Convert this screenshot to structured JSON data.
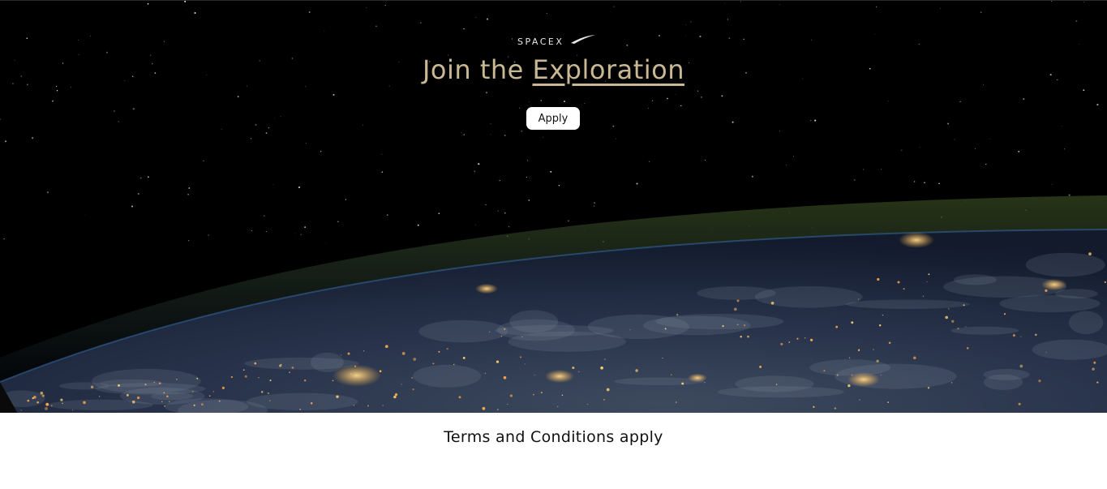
{
  "hero": {
    "logo_text": "SPACEX",
    "headline_prefix": "Join the ",
    "headline_accent": "Exploration",
    "apply_label": "Apply"
  },
  "footer": {
    "terms_text": "Terms and Conditions apply"
  },
  "colors": {
    "headline": "#c9b894",
    "button_bg": "#ffffff",
    "page_bg": "#ffffff",
    "hero_bg": "#000000"
  }
}
